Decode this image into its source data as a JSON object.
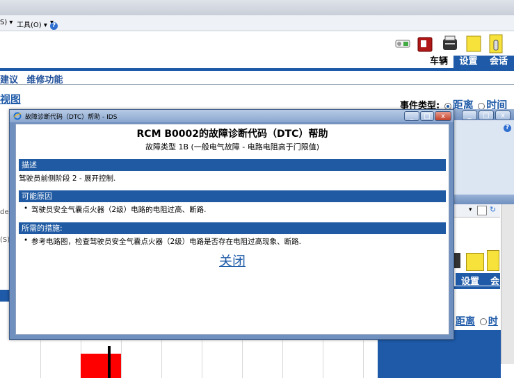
{
  "background": {
    "menu": {
      "partial_item": "S) ▾",
      "tools": "工具(O) ▾"
    },
    "nav_tabs": [
      "车辆",
      "设置",
      "会话"
    ],
    "sub_tabs": [
      "建议",
      "维修功能"
    ],
    "view_link": "视图",
    "event_type": {
      "label": "事件类型:",
      "option_distance": "距离",
      "option_time": "时间"
    },
    "right_window": {
      "nav_tabs": [
        "设置",
        "会"
      ],
      "option_distance": "距离",
      "option_time": "时"
    }
  },
  "dialog": {
    "window_title": "故障诊断代码（DTC）帮助 - IDS",
    "title": "RCM B0002的故障诊断代码（DTC）帮助",
    "subtitle": "故障类型 1B (一般电气故障 - 电路电阻高于门限值)",
    "sections": [
      {
        "header": "描述",
        "text": "驾驶员前侧阶段 2 - 展开控制."
      },
      {
        "header": "可能原因",
        "bullets": [
          "驾驶员安全气囊点火器（2级）电路的电阻过高、断路."
        ]
      },
      {
        "header": "所需的措施:",
        "bullets": [
          "参考电路图，检查驾驶员安全气囊点火器（2级）电路是否存在电阻过高现象、断路."
        ]
      }
    ],
    "close_label": "关闭",
    "window_buttons": {
      "minimize": "_",
      "maximize": "□",
      "close": "x"
    }
  },
  "colors": {
    "accent_blue": "#1f5aa3",
    "link_blue": "#1e5aa8",
    "titlebar": "#8aa6cf",
    "chart_red": "#ff0000"
  }
}
